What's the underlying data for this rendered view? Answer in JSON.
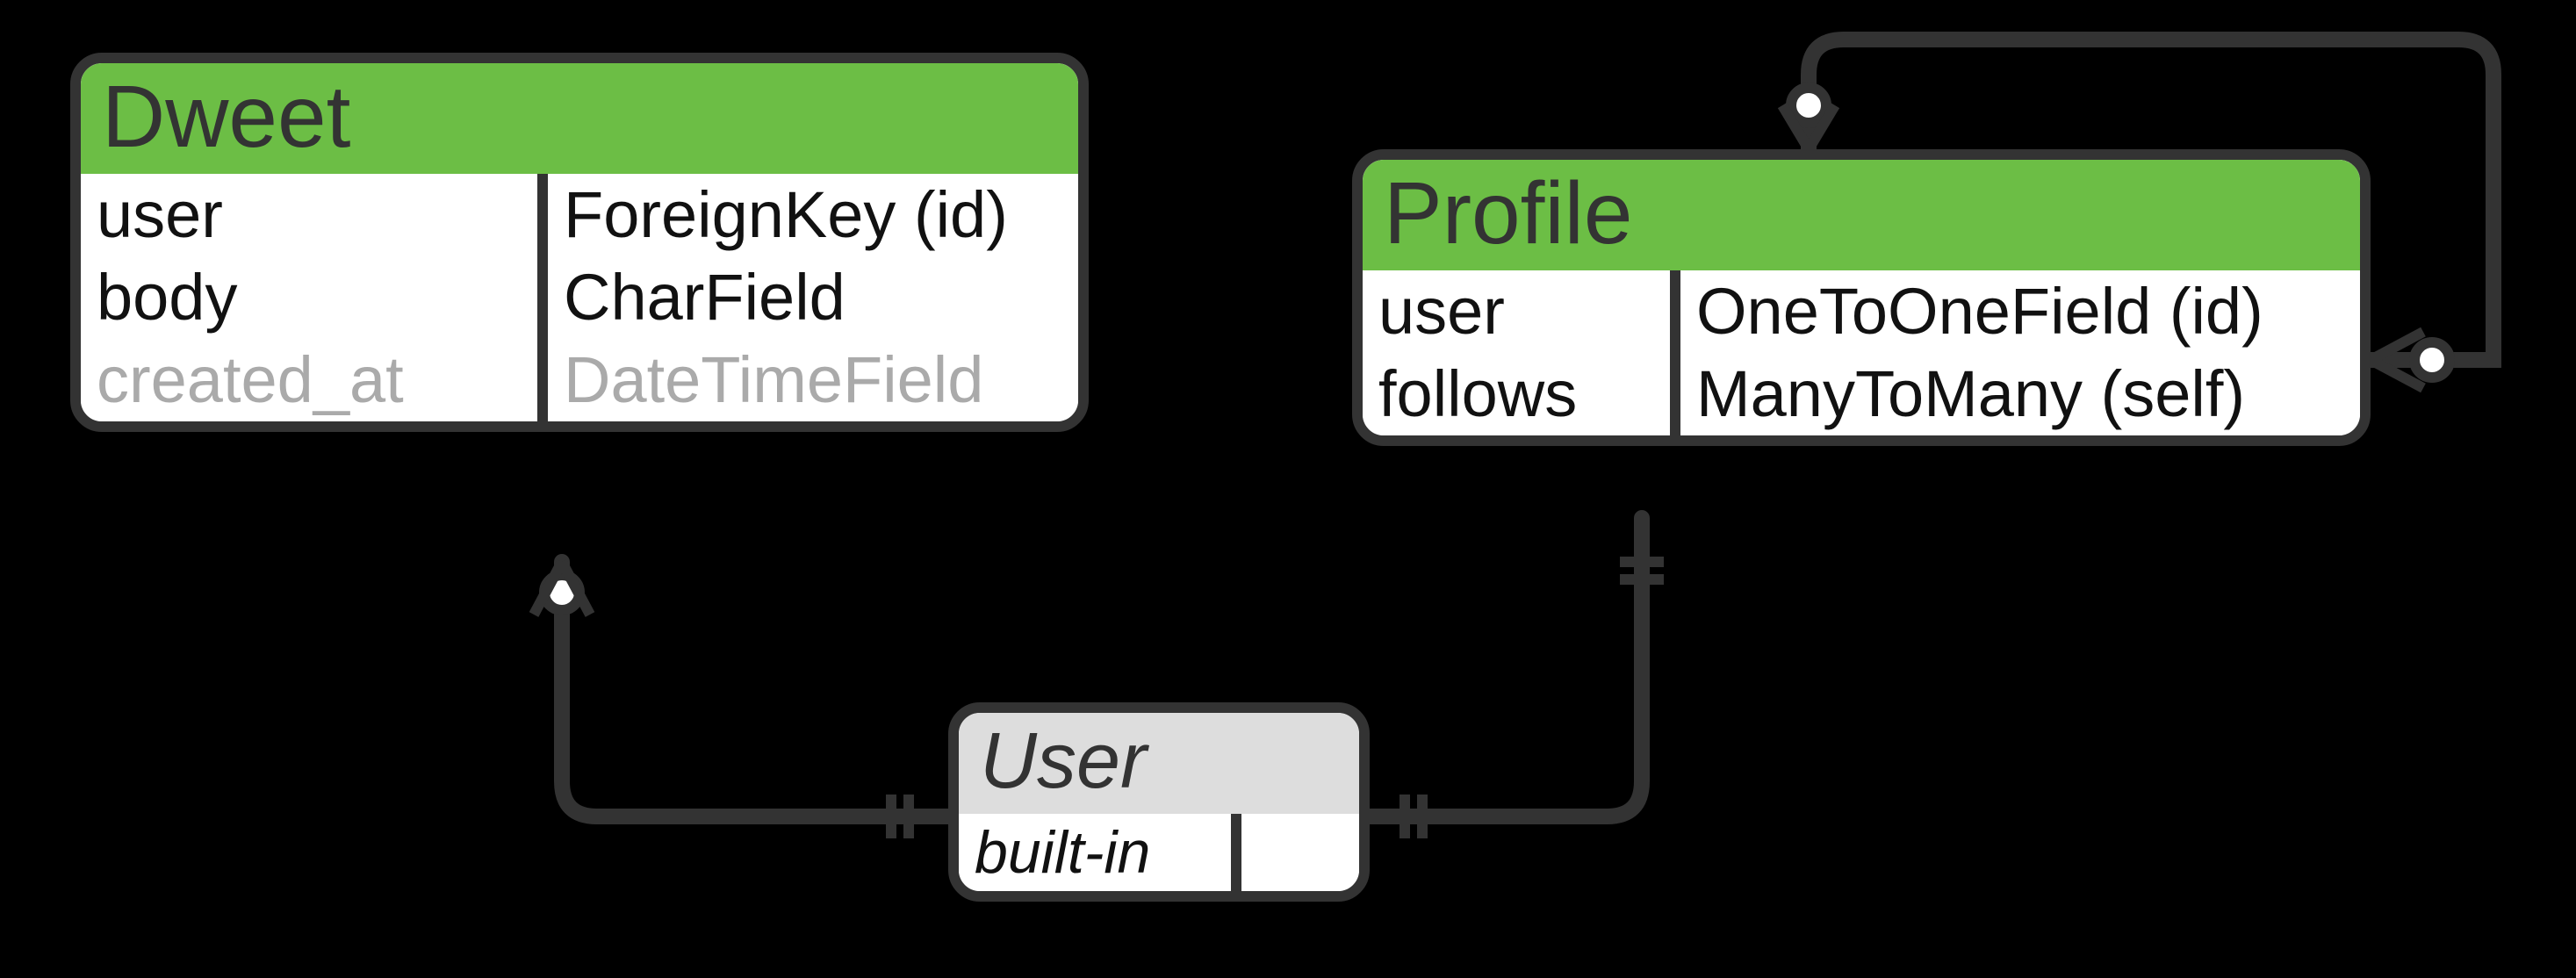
{
  "entities": {
    "dweet": {
      "title": "Dweet",
      "fields": [
        {
          "name": "user",
          "type": "ForeignKey (id)",
          "muted": false
        },
        {
          "name": "body",
          "type": "CharField",
          "muted": false
        },
        {
          "name": "created_at",
          "type": "DateTimeField",
          "muted": true
        }
      ]
    },
    "profile": {
      "title": "Profile",
      "fields": [
        {
          "name": "user",
          "type": "OneToOneField (id)",
          "muted": false
        },
        {
          "name": "follows",
          "type": "ManyToMany (self)",
          "muted": false
        }
      ]
    },
    "user": {
      "title": "User",
      "fields": [
        {
          "name": "built-in",
          "type": "",
          "muted": false
        }
      ]
    }
  },
  "relations": [
    {
      "from": "dweet.user",
      "to": "user",
      "kind": "many-to-one"
    },
    {
      "from": "profile.user",
      "to": "user",
      "kind": "one-to-one"
    },
    {
      "from": "profile.follows",
      "to": "profile",
      "kind": "many-to-many-self"
    }
  ],
  "colors": {
    "accent": "#6cbe45",
    "border": "#333333",
    "muted": "#aaaaaa",
    "userHeader": "#dddddd"
  }
}
